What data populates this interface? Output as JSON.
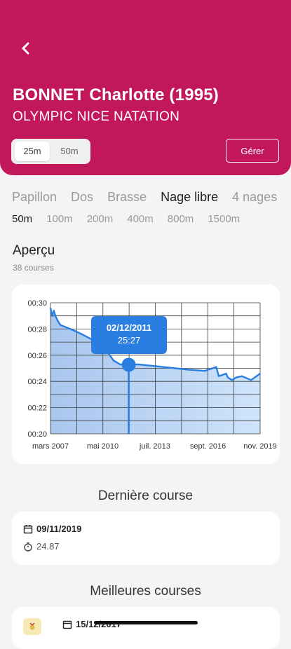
{
  "header": {
    "athlete_name": "BONNET Charlotte (1995)",
    "club": "OLYMPIC NICE NATATION",
    "pool_options": [
      "25m",
      "50m"
    ],
    "pool_selected": "25m",
    "manage_label": "Gérer",
    "accent_color": "#c2185b"
  },
  "strokes": [
    "Papillon",
    "Dos",
    "Brasse",
    "Nage libre",
    "4 nages"
  ],
  "stroke_selected": "Nage libre",
  "distances": [
    "50m",
    "100m",
    "200m",
    "400m",
    "800m",
    "1500m"
  ],
  "distance_selected": "50m",
  "overview": {
    "title": "Aperçu",
    "subtitle": "38 courses"
  },
  "chart_data": {
    "type": "area",
    "x_labels": [
      "mars 2007",
      "mai 2010",
      "juil. 2013",
      "sept. 2016",
      "nov. 2019"
    ],
    "x_tick_years": [
      2007.2,
      2010.35,
      2013.5,
      2016.7,
      2019.85
    ],
    "xlim": [
      2007.2,
      2019.85
    ],
    "y_labels": [
      "00:30",
      "00:28",
      "00:26",
      "00:24",
      "00:22",
      "00:20"
    ],
    "ylim": [
      20,
      30
    ],
    "y_ticks": [
      30,
      28,
      26,
      24,
      22,
      20
    ],
    "grid": true,
    "series": [
      {
        "x": [
          2007.2,
          2007.3,
          2007.4,
          2007.5,
          2007.65,
          2007.8,
          2008.4,
          2009.1,
          2009.7,
          2010.3,
          2011.0,
          2011.4,
          2011.92,
          2012.5,
          2014.0,
          2015.5,
          2016.5,
          2017.2,
          2017.35,
          2017.8,
          2017.9,
          2018.15,
          2018.4,
          2018.75,
          2019.3,
          2019.85
        ],
        "values": [
          29.6,
          29.0,
          29.4,
          29.0,
          28.6,
          28.3,
          28.0,
          27.6,
          27.2,
          26.9,
          25.6,
          25.3,
          25.27,
          25.3,
          25.1,
          24.9,
          24.8,
          25.1,
          24.4,
          24.6,
          24.3,
          24.1,
          24.3,
          24.4,
          24.1,
          24.6
        ],
        "color": "#2a7de1"
      }
    ],
    "highlight": {
      "date": "02/12/2011",
      "value": "25:27",
      "x": 2011.92,
      "y": 25.27
    }
  },
  "last_race": {
    "heading": "Dernière course",
    "date": "09/11/2019",
    "time": "24.87"
  },
  "best_races": {
    "heading": "Meilleures courses",
    "date": "15/12/2017"
  }
}
